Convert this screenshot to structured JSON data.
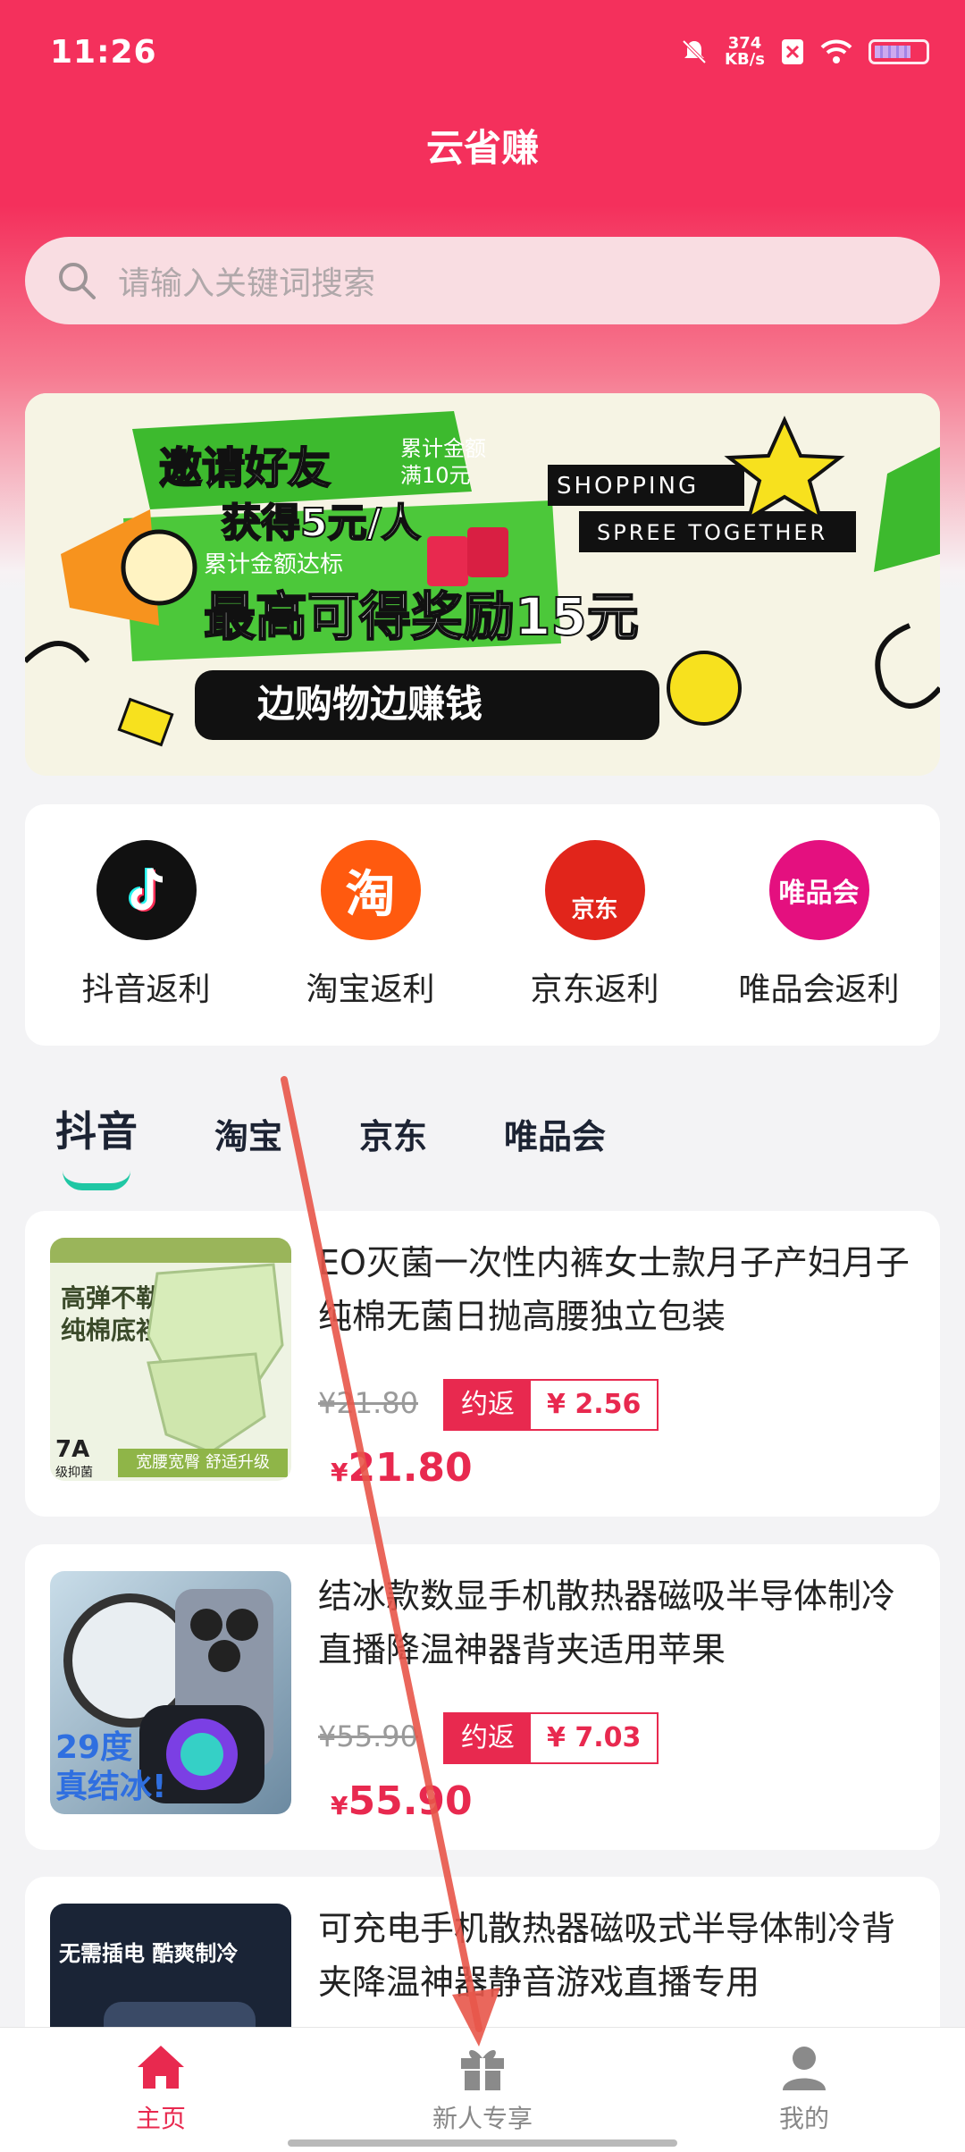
{
  "status_bar": {
    "time": "11:26",
    "net_speed_value": "374",
    "net_speed_unit": "KB/s"
  },
  "app": {
    "title": "云省赚"
  },
  "search": {
    "placeholder": "请输入关键词搜索"
  },
  "banner": {
    "line1": "邀请好友",
    "line2": "获得5元/人",
    "cond1": "累计金额",
    "cond2": "满10元",
    "cond3": "累计金额达标",
    "headline": "最高可得奖励15元",
    "slogan": "边购物边赚钱",
    "tag1": "SHOPPING",
    "tag2": "SPREE TOGETHER"
  },
  "categories": [
    {
      "label": "抖音返利",
      "icon": "douyin-icon",
      "color": "#111111"
    },
    {
      "label": "淘宝返利",
      "icon": "taobao-icon",
      "glyph": "淘",
      "color": "#ff5a0f"
    },
    {
      "label": "京东返利",
      "icon": "jd-icon",
      "glyph": "京东",
      "color": "#e1251b"
    },
    {
      "label": "唯品会返利",
      "icon": "vip-icon",
      "glyph": "唯品会",
      "color": "#e4107f"
    }
  ],
  "tabs": [
    "抖音",
    "淘宝",
    "京东",
    "唯品会"
  ],
  "products": [
    {
      "title": "EO灭菌一次性内裤女士款月子产妇月子纯棉无菌日抛高腰独立包装",
      "original_price": "¥21.80",
      "rebate_label": "约返",
      "rebate_value": "¥ 2.56",
      "price": "21.80",
      "img_text1": "高弹不勒",
      "img_text2": "纯棉底裆",
      "img_text3": "宽腰宽臀 舒适升级",
      "img_text4": "7A",
      "img_text5": "级抑菌"
    },
    {
      "title": "结冰款数显手机散热器磁吸半导体制冷直播降温神器背夹适用苹果",
      "original_price": "¥55.90",
      "rebate_label": "约返",
      "rebate_value": "¥ 7.03",
      "price": "55.90",
      "img_text1": "29度",
      "img_text2": "真结冰!"
    },
    {
      "title": "可充电手机散热器磁吸式半导体制冷背夹降温神器静音游戏直播专用",
      "img_text1": "无需插电 酷爽制冷"
    }
  ],
  "currency_symbol": "¥",
  "bottom_nav": [
    {
      "label": "主页",
      "icon": "home-icon",
      "active": true
    },
    {
      "label": "新人专享",
      "icon": "gift-icon",
      "active": false
    },
    {
      "label": "我的",
      "icon": "user-icon",
      "active": false
    }
  ],
  "colors": {
    "primary": "#f4305c",
    "accent": "#e8294f",
    "tab_indicator": "#1fc7a4",
    "annotation_arrow": "#e8564a"
  }
}
